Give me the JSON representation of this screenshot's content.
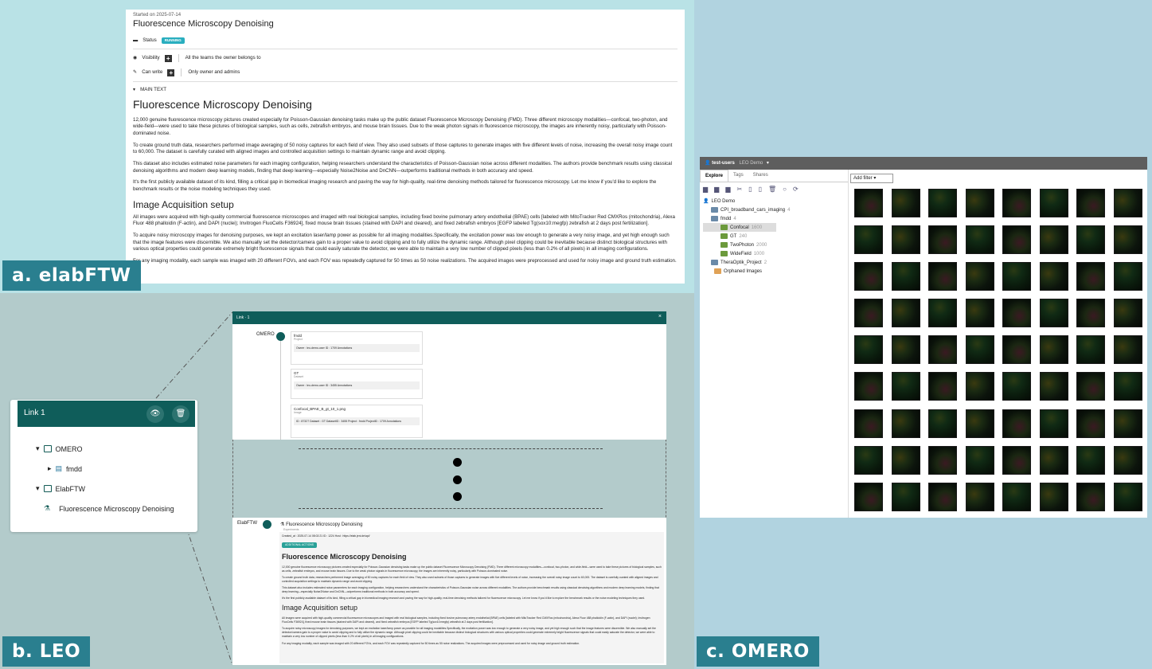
{
  "labels": {
    "a": "a. elabFTW",
    "b": "b. LEO",
    "c": "c. OMERO"
  },
  "elab": {
    "started": "Started on 2025-07-14",
    "title": "Fluorescence Microscopy Denoising",
    "status_label": "Status",
    "status_value": "RUNNING",
    "visibility_label": "Visibility",
    "visibility_value": "All the teams the owner belongs to",
    "canwrite_label": "Can write",
    "canwrite_value": "Only owner and admins",
    "main_text_label": "MAIN TEXT",
    "heading": "Fluorescence Microscopy Denoising",
    "p1": "12,000 genuine fluorescence microscopy pictures created especially for Poisson-Gaussian denoising tasks make up the public dataset Fluorescence Microscopy Denoising (FMD). Three different microscopy modalities—confocal, two-photon, and wide-field—were used to take these pictures of biological samples, such as cells, zebrafish embryos, and mouse brain tissues. Due to the weak photon signals in fluorescence microscopy, the images are inherently noisy, particularly with Poisson-dominated noise.",
    "p2": "To create ground truth data, researchers performed image averaging of 50 noisy captures for each field of view. They also used subsets of those captures to generate images with five different levels of noise, increasing the overall noisy image count to 60,000. The dataset is carefully curated with aligned images and controlled acquisition settings to maintain dynamic range and avoid clipping.",
    "p3": "This dataset also includes estimated noise parameters for each imaging configuration, helping researchers understand the characteristics of Poisson-Gaussian noise across different modalities. The authors provide benchmark results using classical denoising algorithms and modern deep learning models, finding that deep learning—especially Noise2Noise and DnCNN—outperforms traditional methods in both accuracy and speed.",
    "p4": "It's the first publicly available dataset of its kind, filling a critical gap in biomedical imaging research and paving the way for high-quality, real-time denoising methods tailored for fluorescence microscopy. Let me know if you'd like to explore the benchmark results or the noise modeling techniques they used.",
    "subheading": "Image Acquisition setup",
    "p5": "All images were acquired with high-quality commercial fluorescence microscopes and imaged with real biological samples, including fixed bovine pulmonary artery endothelial (BPAE) cells [labeled with MitoTracker Red CMXRos (mitochondria), Alexa Fluor 488 phalloidin (F-actin), and DAPI (nuclei); Invitrogen FluoCells F36924], fixed mouse brain tissues (stained with DAPI and cleared), and fixed zebrafish embryos [EGFP labeled Tg(sox10:megfp) zebrafish at 2 days post fertilization].",
    "p6": "To acquire noisy microscopy images for denoising purposes, we kept an excitation laser/lamp power as possible for all imaging modalities.Specifically, the excitation power was low enough to generate a very noisy image, and yet high enough such that the image features were discernible. We also manually set the detector/camera gain to a proper value to avoid clipping and to fully utilize the dynamic range. Although pixel clipping could be inevitable because distinct biological structures with various optical properties could generate extremely bright fluorescence signals that could easily saturate the detector, we were able to maintain a very low number of clipped pixels (less than 0.2% of all pixels) in all imaging configurations.",
    "p7": "For any imaging modality, each sample was imaged with 20 different FOVs, and each FOV was repeatedly captured for 50 times as 50 noise realizations. The acquired images were preprocessed and used for noisy image and ground truth estimation."
  },
  "leo": {
    "card_title": "Link 1",
    "omero": "OMERO",
    "fmdd": "fmdd",
    "elabftw": "ElabFTW",
    "experiment": "Fluorescence Microscopy Denoising"
  },
  "link": {
    "title": "Link · 1",
    "close": "×",
    "omero_label": "OMERO",
    "items": [
      {
        "name": "fmdd",
        "type": "Project",
        "meta": "Owner : leo-demo-user   ID : 1709   Annotations"
      },
      {
        "name": "GT",
        "type": "Dataset",
        "meta": "Owner : leo-demo-user   ID : 3455   Annotations"
      },
      {
        "name": "Confocal_BPAE_B_gt_10_1.png",
        "type": "Image",
        "meta": "ID : 87327   Dataset : GT   DatasetID : 3455   Project : fmdd   ProjectID : 1709   Annotations"
      }
    ],
    "elab_label": "ElabFTW",
    "elab_title": "Fluorescence Microscopy Denoising",
    "elab_sub": "Experiments",
    "elab_meta": "Created_at : 2025-07-14 08:02:21   ID : 1224   Host : https://elab.jeni.de/api/",
    "additional_actions": "ADDITIONAL ACTIONS",
    "heading": "Fluorescence Microscopy Denoising",
    "subheading": "Image Acquisition setup"
  },
  "omero": {
    "user": "test-users",
    "group": "LEO Demo",
    "tabs": [
      "Explore",
      "Tags",
      "Shares"
    ],
    "filter": "Add filter",
    "tree": [
      {
        "label": "LEO Demo",
        "count": ""
      },
      {
        "label": "CPI_broadband_cars_imaging",
        "count": "4"
      },
      {
        "label": "fmdd",
        "count": "4"
      },
      {
        "label": "Confocal",
        "count": "1600"
      },
      {
        "label": "GT",
        "count": "240"
      },
      {
        "label": "TwoPhoton",
        "count": "2000"
      },
      {
        "label": "WideField",
        "count": "1000"
      },
      {
        "label": "TheraOptik_Project",
        "count": "2"
      },
      {
        "label": "Orphaned Images",
        "count": ""
      }
    ]
  }
}
